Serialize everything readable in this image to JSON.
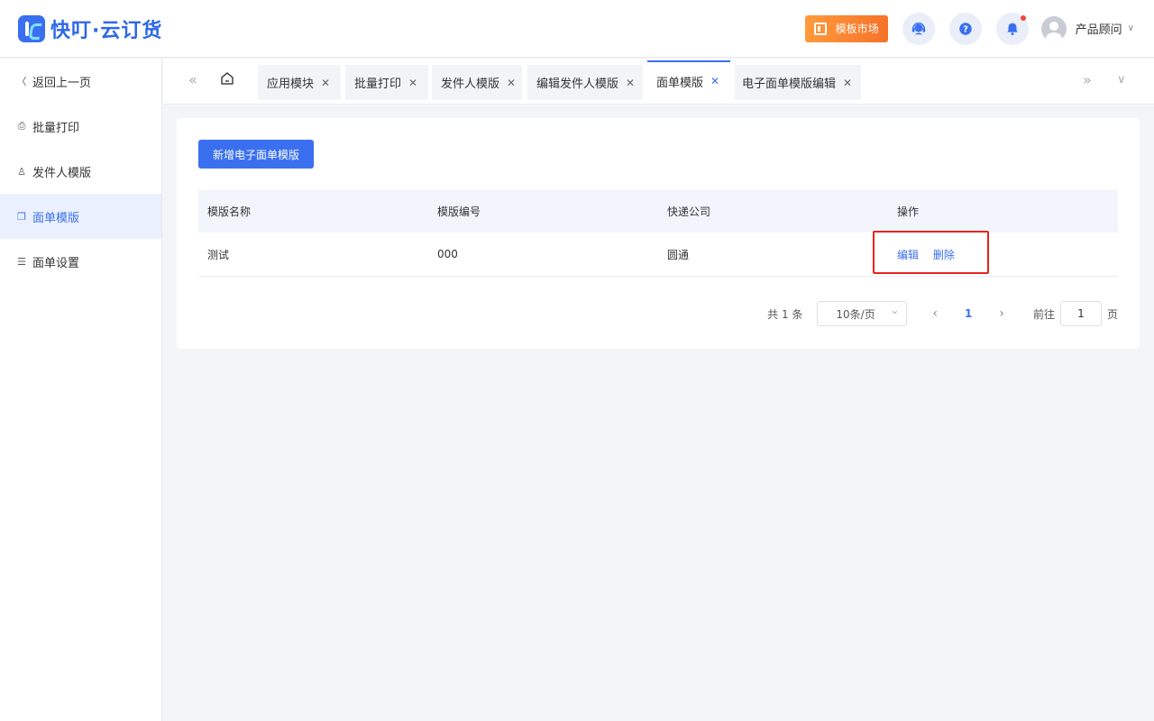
{
  "header": {
    "brand": "快叮·云订货",
    "market_button": "模板市场",
    "user_name": "产品顾问",
    "colors": {
      "brand": "#3a6ff0",
      "market": "#f5732a",
      "notify_dot": "#f5453a"
    }
  },
  "sidebar": {
    "back": "返回上一页",
    "items": [
      {
        "label": "批量打印",
        "icon": "printer-icon"
      },
      {
        "label": "发件人模版",
        "icon": "user-icon"
      },
      {
        "label": "面单模版",
        "icon": "document-copy-icon",
        "active": true
      },
      {
        "label": "面单设置",
        "icon": "layers-icon"
      }
    ]
  },
  "tabs": [
    {
      "label": "应用模块"
    },
    {
      "label": "批量打印"
    },
    {
      "label": "发件人模版"
    },
    {
      "label": "编辑发件人模版"
    },
    {
      "label": "面单模版",
      "active": true
    },
    {
      "label": "电子面单模版编辑"
    }
  ],
  "main": {
    "add_button": "新增电子面单模版",
    "table": {
      "columns": [
        "模版名称",
        "模版编号",
        "快递公司",
        "操作"
      ],
      "rows": [
        {
          "name": "测试",
          "code": "000",
          "courier": "圆通",
          "actions": [
            "编辑",
            "删除"
          ]
        }
      ]
    },
    "pager": {
      "total": "共 1 条",
      "page_size": "10条/页",
      "current_page": "1",
      "goto_label": "前往",
      "goto_value": "1",
      "page_suffix": "页"
    }
  }
}
